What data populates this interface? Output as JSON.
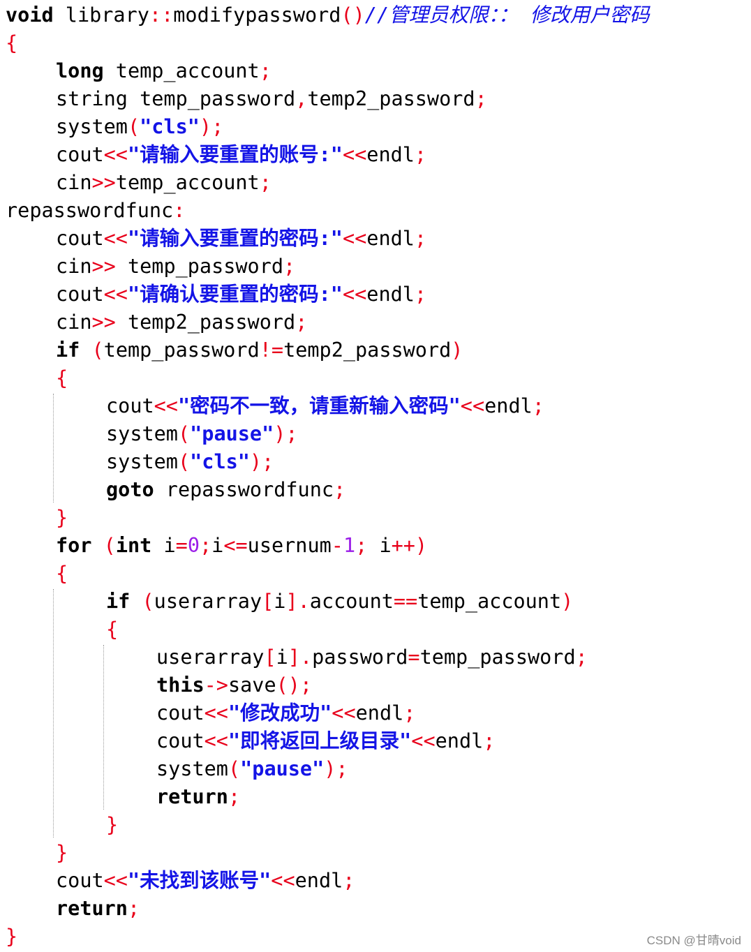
{
  "editor": {
    "language": "cpp",
    "colors": {
      "keyword": "#000000",
      "operator": "#e8001a",
      "string": "#1414e6",
      "number": "#9b1de8",
      "comment": "#1414e6",
      "text": "#000000"
    },
    "lines": [
      {
        "indent": 0,
        "tokens": [
          {
            "t": "kw",
            "v": "void"
          },
          {
            "t": "tx",
            "v": " library"
          },
          {
            "t": "op",
            "v": "::"
          },
          {
            "t": "tx",
            "v": "modifypassword"
          },
          {
            "t": "op",
            "v": "()"
          },
          {
            "t": "cm",
            "v": "//管理员权限：： 修改用户密码"
          }
        ]
      },
      {
        "indent": 0,
        "tokens": [
          {
            "t": "op",
            "v": "{"
          }
        ]
      },
      {
        "indent": 1,
        "tokens": [
          {
            "t": "kw",
            "v": "long"
          },
          {
            "t": "tx",
            "v": " temp_account"
          },
          {
            "t": "op",
            "v": ";"
          }
        ]
      },
      {
        "indent": 1,
        "tokens": [
          {
            "t": "tx",
            "v": "string temp_password"
          },
          {
            "t": "op",
            "v": ","
          },
          {
            "t": "tx",
            "v": "temp2_password"
          },
          {
            "t": "op",
            "v": ";"
          }
        ]
      },
      {
        "indent": 1,
        "tokens": [
          {
            "t": "tx",
            "v": "system"
          },
          {
            "t": "op",
            "v": "("
          },
          {
            "t": "str",
            "v": "\"cls\""
          },
          {
            "t": "op",
            "v": ");"
          }
        ]
      },
      {
        "indent": 1,
        "tokens": [
          {
            "t": "tx",
            "v": "cout"
          },
          {
            "t": "op",
            "v": "<<"
          },
          {
            "t": "str",
            "v": "\"请输入要重置的账号:\""
          },
          {
            "t": "op",
            "v": "<<"
          },
          {
            "t": "tx",
            "v": "endl"
          },
          {
            "t": "op",
            "v": ";"
          }
        ]
      },
      {
        "indent": 1,
        "tokens": [
          {
            "t": "tx",
            "v": "cin"
          },
          {
            "t": "op",
            "v": ">>"
          },
          {
            "t": "tx",
            "v": "temp_account"
          },
          {
            "t": "op",
            "v": ";"
          }
        ]
      },
      {
        "indent": 0,
        "tokens": [
          {
            "t": "tx",
            "v": "repasswordfunc"
          },
          {
            "t": "op",
            "v": ":"
          }
        ]
      },
      {
        "indent": 1,
        "tokens": [
          {
            "t": "tx",
            "v": "cout"
          },
          {
            "t": "op",
            "v": "<<"
          },
          {
            "t": "str",
            "v": "\"请输入要重置的密码:\""
          },
          {
            "t": "op",
            "v": "<<"
          },
          {
            "t": "tx",
            "v": "endl"
          },
          {
            "t": "op",
            "v": ";"
          }
        ]
      },
      {
        "indent": 1,
        "tokens": [
          {
            "t": "tx",
            "v": "cin"
          },
          {
            "t": "op",
            "v": ">>"
          },
          {
            "t": "tx",
            "v": " temp_password"
          },
          {
            "t": "op",
            "v": ";"
          }
        ]
      },
      {
        "indent": 1,
        "tokens": [
          {
            "t": "tx",
            "v": "cout"
          },
          {
            "t": "op",
            "v": "<<"
          },
          {
            "t": "str",
            "v": "\"请确认要重置的密码:\""
          },
          {
            "t": "op",
            "v": "<<"
          },
          {
            "t": "tx",
            "v": "endl"
          },
          {
            "t": "op",
            "v": ";"
          }
        ]
      },
      {
        "indent": 1,
        "tokens": [
          {
            "t": "tx",
            "v": "cin"
          },
          {
            "t": "op",
            "v": ">>"
          },
          {
            "t": "tx",
            "v": " temp2_password"
          },
          {
            "t": "op",
            "v": ";"
          }
        ]
      },
      {
        "indent": 1,
        "tokens": [
          {
            "t": "kw",
            "v": "if"
          },
          {
            "t": "tx",
            "v": " "
          },
          {
            "t": "op",
            "v": "("
          },
          {
            "t": "tx",
            "v": "temp_password"
          },
          {
            "t": "op",
            "v": "!="
          },
          {
            "t": "tx",
            "v": "temp2_password"
          },
          {
            "t": "op",
            "v": ")"
          }
        ]
      },
      {
        "indent": 1,
        "tokens": [
          {
            "t": "op",
            "v": "{"
          }
        ]
      },
      {
        "indent": 2,
        "tokens": [
          {
            "t": "tx",
            "v": "cout"
          },
          {
            "t": "op",
            "v": "<<"
          },
          {
            "t": "str",
            "v": "\"密码不一致，请重新输入密码\""
          },
          {
            "t": "op",
            "v": "<<"
          },
          {
            "t": "tx",
            "v": "endl"
          },
          {
            "t": "op",
            "v": ";"
          }
        ]
      },
      {
        "indent": 2,
        "tokens": [
          {
            "t": "tx",
            "v": "system"
          },
          {
            "t": "op",
            "v": "("
          },
          {
            "t": "str",
            "v": "\"pause\""
          },
          {
            "t": "op",
            "v": ");"
          }
        ]
      },
      {
        "indent": 2,
        "tokens": [
          {
            "t": "tx",
            "v": "system"
          },
          {
            "t": "op",
            "v": "("
          },
          {
            "t": "str",
            "v": "\"cls\""
          },
          {
            "t": "op",
            "v": ");"
          }
        ]
      },
      {
        "indent": 2,
        "tokens": [
          {
            "t": "kw",
            "v": "goto"
          },
          {
            "t": "tx",
            "v": " repasswordfunc"
          },
          {
            "t": "op",
            "v": ";"
          }
        ]
      },
      {
        "indent": 1,
        "tokens": [
          {
            "t": "op",
            "v": "}"
          }
        ]
      },
      {
        "indent": 1,
        "tokens": [
          {
            "t": "kw",
            "v": "for"
          },
          {
            "t": "tx",
            "v": " "
          },
          {
            "t": "op",
            "v": "("
          },
          {
            "t": "kw",
            "v": "int"
          },
          {
            "t": "tx",
            "v": " i"
          },
          {
            "t": "op",
            "v": "="
          },
          {
            "t": "num",
            "v": "0"
          },
          {
            "t": "op",
            "v": ";"
          },
          {
            "t": "tx",
            "v": "i"
          },
          {
            "t": "op",
            "v": "<="
          },
          {
            "t": "tx",
            "v": "usernum"
          },
          {
            "t": "op",
            "v": "-"
          },
          {
            "t": "num",
            "v": "1"
          },
          {
            "t": "op",
            "v": ";"
          },
          {
            "t": "tx",
            "v": " i"
          },
          {
            "t": "op",
            "v": "++)"
          }
        ]
      },
      {
        "indent": 1,
        "tokens": [
          {
            "t": "op",
            "v": "{"
          }
        ]
      },
      {
        "indent": 2,
        "tokens": [
          {
            "t": "kw",
            "v": "if"
          },
          {
            "t": "tx",
            "v": " "
          },
          {
            "t": "op",
            "v": "("
          },
          {
            "t": "tx",
            "v": "userarray"
          },
          {
            "t": "op",
            "v": "["
          },
          {
            "t": "tx",
            "v": "i"
          },
          {
            "t": "op",
            "v": "]."
          },
          {
            "t": "tx",
            "v": "account"
          },
          {
            "t": "op",
            "v": "=="
          },
          {
            "t": "tx",
            "v": "temp_account"
          },
          {
            "t": "op",
            "v": ")"
          }
        ]
      },
      {
        "indent": 2,
        "tokens": [
          {
            "t": "op",
            "v": "{"
          }
        ]
      },
      {
        "indent": 3,
        "tokens": [
          {
            "t": "tx",
            "v": "userarray"
          },
          {
            "t": "op",
            "v": "["
          },
          {
            "t": "tx",
            "v": "i"
          },
          {
            "t": "op",
            "v": "]."
          },
          {
            "t": "tx",
            "v": "password"
          },
          {
            "t": "op",
            "v": "="
          },
          {
            "t": "tx",
            "v": "temp_password"
          },
          {
            "t": "op",
            "v": ";"
          }
        ]
      },
      {
        "indent": 3,
        "tokens": [
          {
            "t": "kw",
            "v": "this"
          },
          {
            "t": "op",
            "v": "->"
          },
          {
            "t": "tx",
            "v": "save"
          },
          {
            "t": "op",
            "v": "();"
          }
        ]
      },
      {
        "indent": 3,
        "tokens": [
          {
            "t": "tx",
            "v": "cout"
          },
          {
            "t": "op",
            "v": "<<"
          },
          {
            "t": "str",
            "v": "\"修改成功\""
          },
          {
            "t": "op",
            "v": "<<"
          },
          {
            "t": "tx",
            "v": "endl"
          },
          {
            "t": "op",
            "v": ";"
          }
        ]
      },
      {
        "indent": 3,
        "tokens": [
          {
            "t": "tx",
            "v": "cout"
          },
          {
            "t": "op",
            "v": "<<"
          },
          {
            "t": "str",
            "v": "\"即将返回上级目录\""
          },
          {
            "t": "op",
            "v": "<<"
          },
          {
            "t": "tx",
            "v": "endl"
          },
          {
            "t": "op",
            "v": ";"
          }
        ]
      },
      {
        "indent": 3,
        "tokens": [
          {
            "t": "tx",
            "v": "system"
          },
          {
            "t": "op",
            "v": "("
          },
          {
            "t": "str",
            "v": "\"pause\""
          },
          {
            "t": "op",
            "v": ");"
          }
        ]
      },
      {
        "indent": 3,
        "tokens": [
          {
            "t": "kw",
            "v": "return"
          },
          {
            "t": "op",
            "v": ";"
          }
        ]
      },
      {
        "indent": 2,
        "tokens": [
          {
            "t": "op",
            "v": "}"
          }
        ]
      },
      {
        "indent": 1,
        "tokens": [
          {
            "t": "op",
            "v": "}"
          }
        ]
      },
      {
        "indent": 1,
        "tokens": [
          {
            "t": "tx",
            "v": "cout"
          },
          {
            "t": "op",
            "v": "<<"
          },
          {
            "t": "str",
            "v": "\"未找到该账号\""
          },
          {
            "t": "op",
            "v": "<<"
          },
          {
            "t": "tx",
            "v": "endl"
          },
          {
            "t": "op",
            "v": ";"
          }
        ]
      },
      {
        "indent": 1,
        "tokens": [
          {
            "t": "kw",
            "v": "return"
          },
          {
            "t": "op",
            "v": ";"
          }
        ]
      },
      {
        "indent": 0,
        "tokens": [
          {
            "t": "op",
            "v": "}"
          }
        ]
      }
    ],
    "guides": [
      {
        "indent": 1,
        "from_line": 14,
        "to_line": 17
      },
      {
        "indent": 1,
        "from_line": 21,
        "to_line": 29
      },
      {
        "indent": 2,
        "from_line": 23,
        "to_line": 28
      }
    ]
  },
  "watermark": "CSDN @甘晴void"
}
